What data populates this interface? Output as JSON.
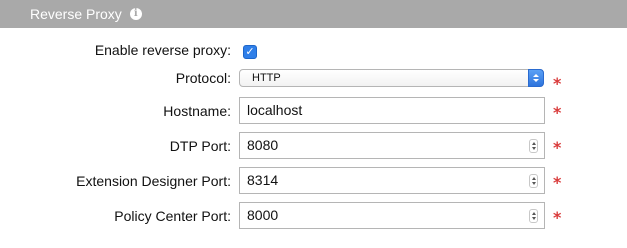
{
  "section": {
    "title": "Reverse Proxy",
    "info_icon": "info-icon"
  },
  "colors": {
    "header_bg": "#a9a9a9",
    "required_star": "#d93a3a",
    "accent": "#2f7fe9"
  },
  "form": {
    "enable": {
      "label": "Enable reverse proxy:",
      "checked": true
    },
    "protocol": {
      "label": "Protocol:",
      "value": "HTTP",
      "required_mark": "*"
    },
    "hostname": {
      "label": "Hostname:",
      "value": "localhost",
      "required_mark": "*"
    },
    "dtp_port": {
      "label": "DTP Port:",
      "value": "8080",
      "required_mark": "*"
    },
    "ext_port": {
      "label": "Extension Designer Port:",
      "value": "8314",
      "required_mark": "*"
    },
    "policy_port": {
      "label": "Policy Center Port:",
      "value": "8000",
      "required_mark": "*"
    }
  }
}
